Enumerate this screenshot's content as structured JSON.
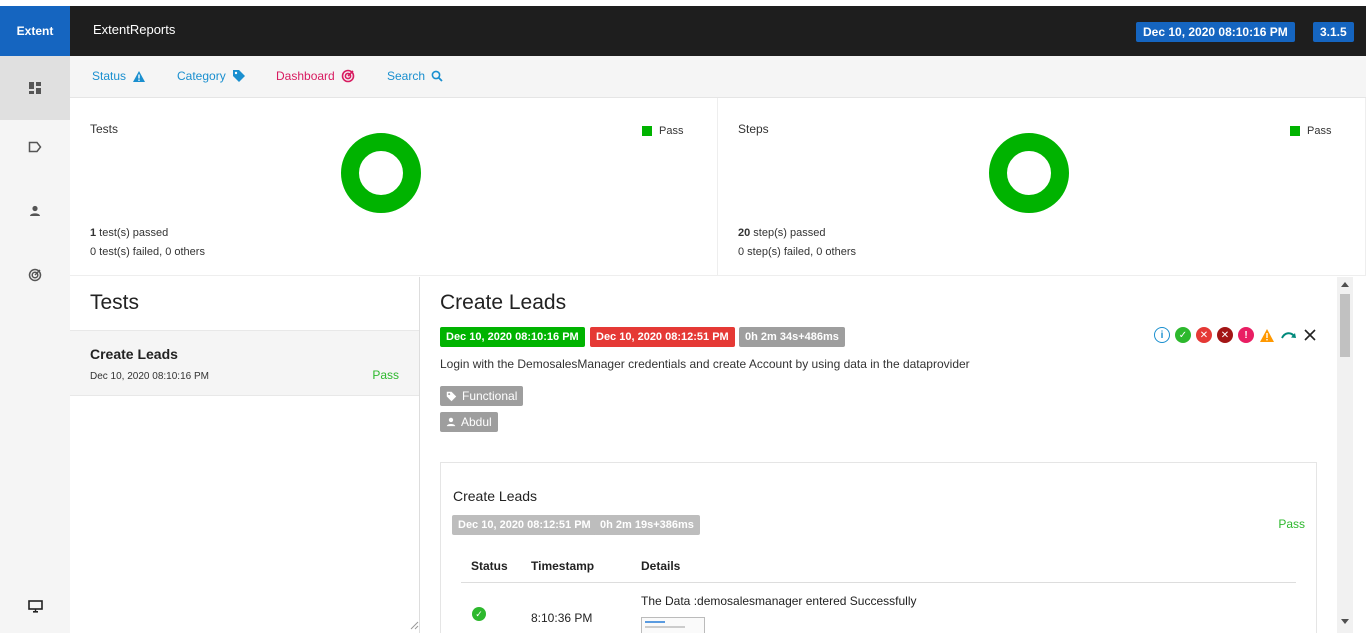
{
  "header": {
    "brand": "Extent",
    "title": "ExtentReports",
    "run_time": "Dec 10, 2020 08:10:16 PM",
    "version": "3.1.5",
    "bar_color": "#1e1e1e",
    "accent_color": "#1565c0"
  },
  "sidebar": {
    "items": [
      {
        "icon": "dashboard-grid-icon",
        "active": true
      },
      {
        "icon": "tag-outline-icon",
        "active": false
      },
      {
        "icon": "person-icon",
        "active": false
      },
      {
        "icon": "radar-icon",
        "active": false
      }
    ],
    "bottom_icon": "monitor-icon"
  },
  "nav": {
    "items": [
      {
        "label": "Status",
        "icon": "warning-triangle-icon",
        "color": "#1a8fcf"
      },
      {
        "label": "Category",
        "icon": "tag-icon",
        "color": "#1a8fcf"
      },
      {
        "label": "Dashboard",
        "icon": "radar-icon",
        "color": "#d81b60"
      },
      {
        "label": "Search",
        "icon": "search-icon",
        "color": "#1a8fcf"
      }
    ]
  },
  "cards": {
    "tests": {
      "title": "Tests",
      "legend": "Pass",
      "pass_fraction": 1.0,
      "passed_count": "1",
      "passed_text": " test(s) passed",
      "failed_text": "0 test(s) failed, 0 others"
    },
    "steps": {
      "title": "Steps",
      "legend": "Pass",
      "pass_fraction": 1.0,
      "passed_count": "20",
      "passed_text": " step(s) passed",
      "failed_text": "0 step(s) failed, 0 others"
    },
    "pass_color": "#00b300"
  },
  "test_list": {
    "heading": "Tests",
    "items": [
      {
        "name": "Create Leads",
        "time": "Dec 10, 2020 08:10:16 PM",
        "status": "Pass"
      }
    ]
  },
  "detail": {
    "title": "Create Leads",
    "start_time": "Dec 10, 2020 08:10:16 PM",
    "end_time": "Dec 10, 2020 08:12:51 PM",
    "duration": "0h 2m 34s+486ms",
    "description": "Login with the DemosalesManager credentials and create Account by using data in the dataprovider",
    "category": "Functional",
    "author": "Abdul",
    "status_icons": [
      "info-icon",
      "pass-check-icon",
      "fail-icon",
      "fatal-icon",
      "error-icon",
      "warning-icon",
      "skip-icon",
      "close-icon"
    ],
    "start_color": "#00b300",
    "end_color": "#e53935",
    "duration_color": "#9e9e9e",
    "node": {
      "title": "Create Leads",
      "end_time": "Dec 10, 2020 08:12:51 PM",
      "duration": "0h 2m 19s+386ms",
      "status": "Pass",
      "columns": [
        "Status",
        "Timestamp",
        "Details"
      ],
      "rows": [
        {
          "status_icon": "pass-check-icon",
          "timestamp": "8:10:36 PM",
          "details": "The Data :demosalesmanager entered Successfully"
        }
      ]
    }
  }
}
